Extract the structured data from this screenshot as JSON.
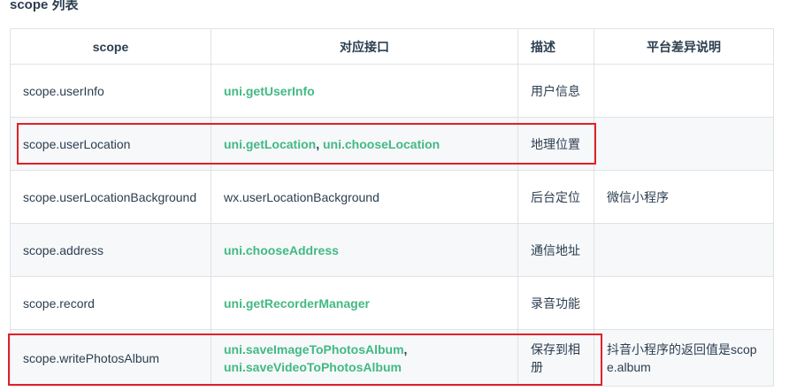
{
  "title": "scope 列表",
  "headers": [
    "scope",
    "对应接口",
    "描述",
    "平台差异说明"
  ],
  "rows": [
    {
      "scope": "scope.userInfo",
      "apis": [
        "uni.getUserInfo"
      ],
      "api_plain": "",
      "desc": "用户信息",
      "platform": ""
    },
    {
      "scope": "scope.userLocation",
      "apis": [
        "uni.getLocation",
        "uni.chooseLocation"
      ],
      "api_plain": "",
      "desc": "地理位置",
      "platform": ""
    },
    {
      "scope": "scope.userLocationBackground",
      "apis": [],
      "api_plain": "wx.userLocationBackground",
      "desc": "后台定位",
      "platform": "微信小程序"
    },
    {
      "scope": "scope.address",
      "apis": [
        "uni.chooseAddress"
      ],
      "api_plain": "",
      "desc": "通信地址",
      "platform": ""
    },
    {
      "scope": "scope.record",
      "apis": [
        "uni.getRecorderManager"
      ],
      "api_plain": "",
      "desc": "录音功能",
      "platform": ""
    },
    {
      "scope": "scope.writePhotosAlbum",
      "apis": [
        "uni.saveImageToPhotosAlbum",
        "uni.saveVideoToPhotosAlbum"
      ],
      "api_plain": "",
      "desc": "保存到相册",
      "platform": "抖音小程序的返回值是scope.album"
    }
  ],
  "separator": ", ",
  "colors": {
    "link": "#42b983",
    "text": "#2c3e50",
    "border": "#dfe2e5",
    "stripe": "#f6f8fa",
    "highlight": "#e0202b"
  }
}
